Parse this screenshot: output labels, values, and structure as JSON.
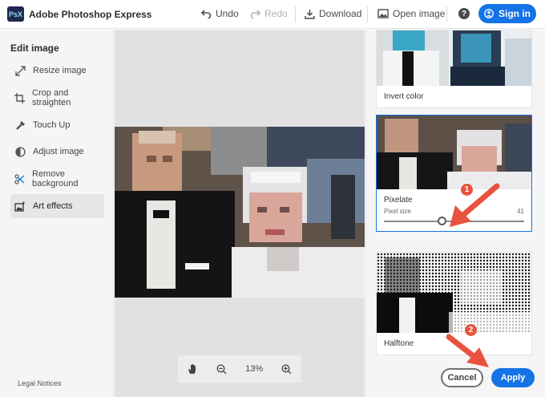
{
  "header": {
    "logo_text": "PsX",
    "app_title": "Adobe Photoshop Express",
    "undo_label": "Undo",
    "redo_label": "Redo",
    "download_label": "Download",
    "open_image_label": "Open image",
    "help_icon": "?",
    "sign_in_label": "Sign in"
  },
  "sidebar": {
    "heading": "Edit image",
    "items": [
      {
        "label": "Resize image",
        "icon": "resize-icon"
      },
      {
        "label": "Crop and straighten",
        "icon": "crop-icon"
      },
      {
        "label": "Touch Up",
        "icon": "touch-up-icon"
      },
      {
        "label": "Adjust image",
        "icon": "adjust-icon"
      },
      {
        "label": "Remove background",
        "icon": "remove-background-icon"
      },
      {
        "label": "Art effects",
        "icon": "art-effects-icon",
        "active": true
      }
    ],
    "legal_label": "Legal Notices"
  },
  "canvas": {
    "zoom_value": "13%"
  },
  "effects": {
    "invert_label": "Invert color",
    "pixelate_label": "Pixelate",
    "pixel_size_label": "Pixel size",
    "pixel_size_value": "41",
    "halftone_label": "Halftone"
  },
  "footer": {
    "cancel_label": "Cancel",
    "apply_label": "Apply"
  },
  "annotations": {
    "step1": "1",
    "step2": "2"
  },
  "colors": {
    "accent": "#1473e6",
    "annotation": "#e8533f"
  }
}
